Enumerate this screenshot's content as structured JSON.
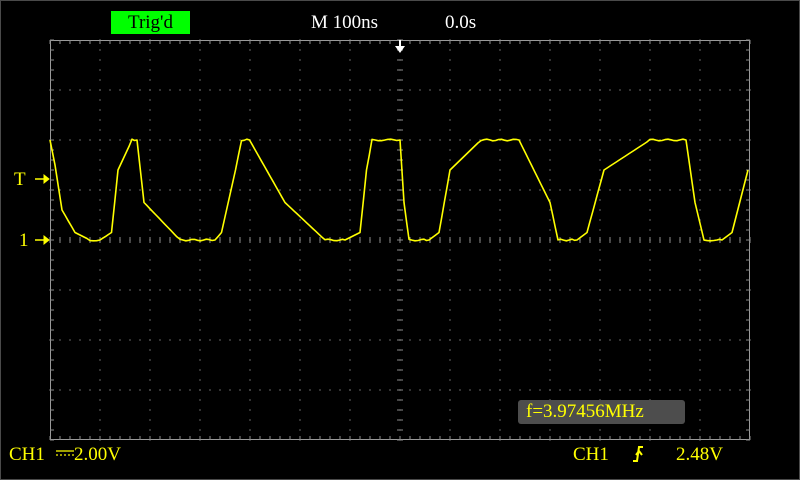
{
  "status": {
    "trigger_state": "Trig'd",
    "timebase": "M 100ns",
    "trigger_position": "0.0s"
  },
  "markers": {
    "trigger_level": "T",
    "channel1": "1"
  },
  "channel1": {
    "label": "CH1",
    "coupling_icon": "dc-coupling-icon",
    "scale": "2.00V"
  },
  "trigger": {
    "source": "CH1",
    "slope_icon": "rising-edge-icon",
    "level": "2.48V"
  },
  "measurement": {
    "frequency": "f=3.97456MHz"
  },
  "colors": {
    "trace": "#ffff00",
    "grid": "#8a8a8a",
    "status_ok": "#00ff00",
    "text": "#ffffff"
  },
  "chart_data": {
    "type": "line",
    "xlim": [
      -700,
      700
    ],
    "ylim": [
      -8,
      8
    ],
    "x_unit": "ns",
    "y_unit": "V",
    "grid": true,
    "x": [
      -700,
      -690,
      -676,
      -650,
      -620,
      -600,
      -577,
      -564,
      -536,
      -526,
      -512,
      -440,
      -370,
      -357,
      -329,
      -317,
      -301,
      -230,
      -150,
      -120,
      -110,
      -80,
      -67,
      -56,
      0,
      8,
      18,
      48,
      58,
      78,
      100,
      162,
      238,
      300,
      316,
      344,
      354,
      374,
      408,
      500,
      572,
      590,
      608,
      634,
      644,
      664,
      696,
      700
    ],
    "y": [
      4.0,
      3.0,
      1.2,
      0.3,
      0.0,
      0.0,
      0.3,
      2.8,
      4.0,
      4.0,
      1.5,
      0.0,
      0.0,
      0.3,
      2.8,
      4.0,
      4.0,
      1.5,
      0.0,
      0.0,
      0.0,
      0.3,
      2.8,
      4.0,
      4.0,
      1.5,
      0.0,
      0.0,
      0.0,
      0.3,
      2.8,
      4.0,
      4.0,
      1.5,
      0.0,
      0.0,
      0.0,
      0.3,
      2.8,
      4.0,
      4.0,
      1.5,
      0.0,
      0.0,
      0.0,
      0.3,
      2.8,
      0.0
    ]
  }
}
